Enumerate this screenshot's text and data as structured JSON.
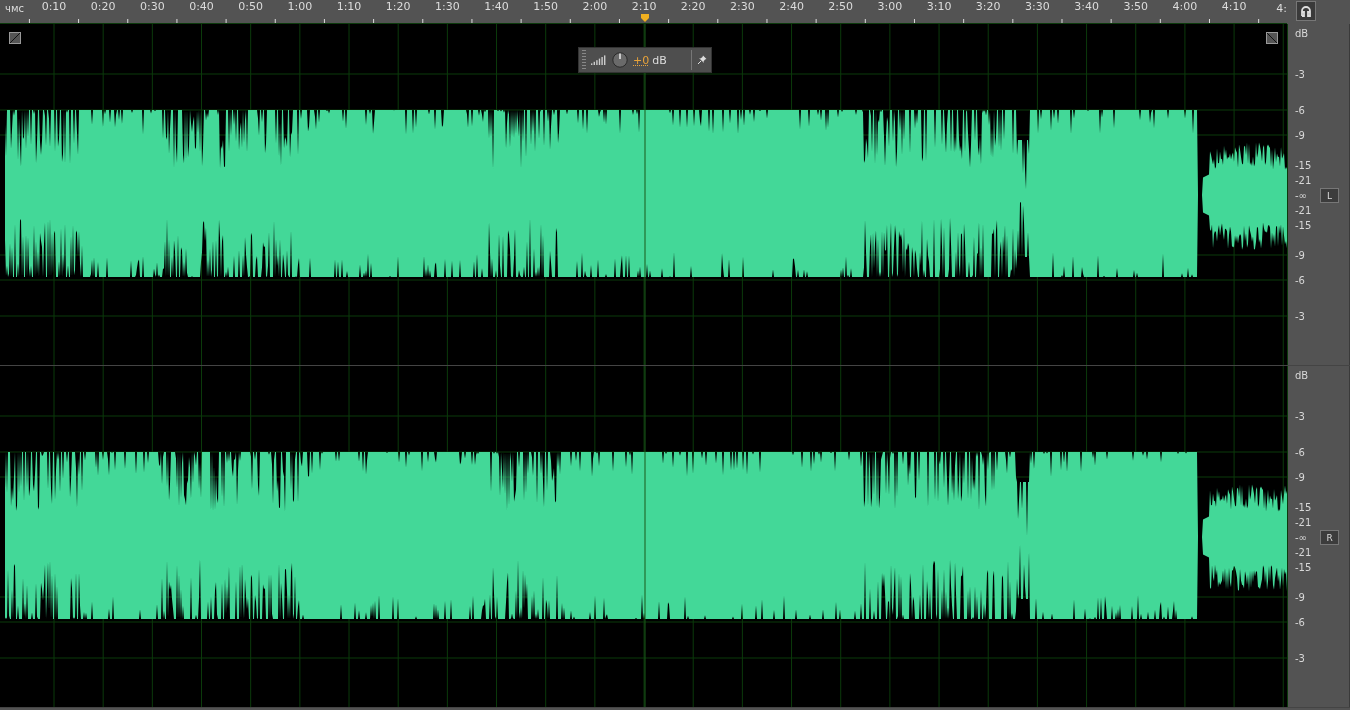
{
  "ruler": {
    "unit_label": "чмс",
    "ticks": [
      "0:10",
      "0:20",
      "0:30",
      "0:40",
      "0:50",
      "1:00",
      "1:10",
      "1:20",
      "1:30",
      "1:40",
      "1:50",
      "2:00",
      "2:10",
      "2:20",
      "2:30",
      "2:40",
      "2:50",
      "3:00",
      "3:10",
      "3:20",
      "3:30",
      "3:40",
      "3:50",
      "4:00",
      "4:10",
      "4:"
    ]
  },
  "hud": {
    "gain": "+0",
    "unit": "dB"
  },
  "channels": [
    {
      "label": "L",
      "scale": [
        "dB",
        "-3",
        "-6",
        "-9",
        "-15",
        "-21",
        "-∞",
        "-21",
        "-15",
        "-9",
        "-6",
        "-3"
      ]
    },
    {
      "label": "R",
      "scale": [
        "dB",
        "-3",
        "-6",
        "-9",
        "-15",
        "-21",
        "-∞",
        "-21",
        "-15",
        "-9",
        "-6",
        "-3"
      ]
    }
  ]
}
